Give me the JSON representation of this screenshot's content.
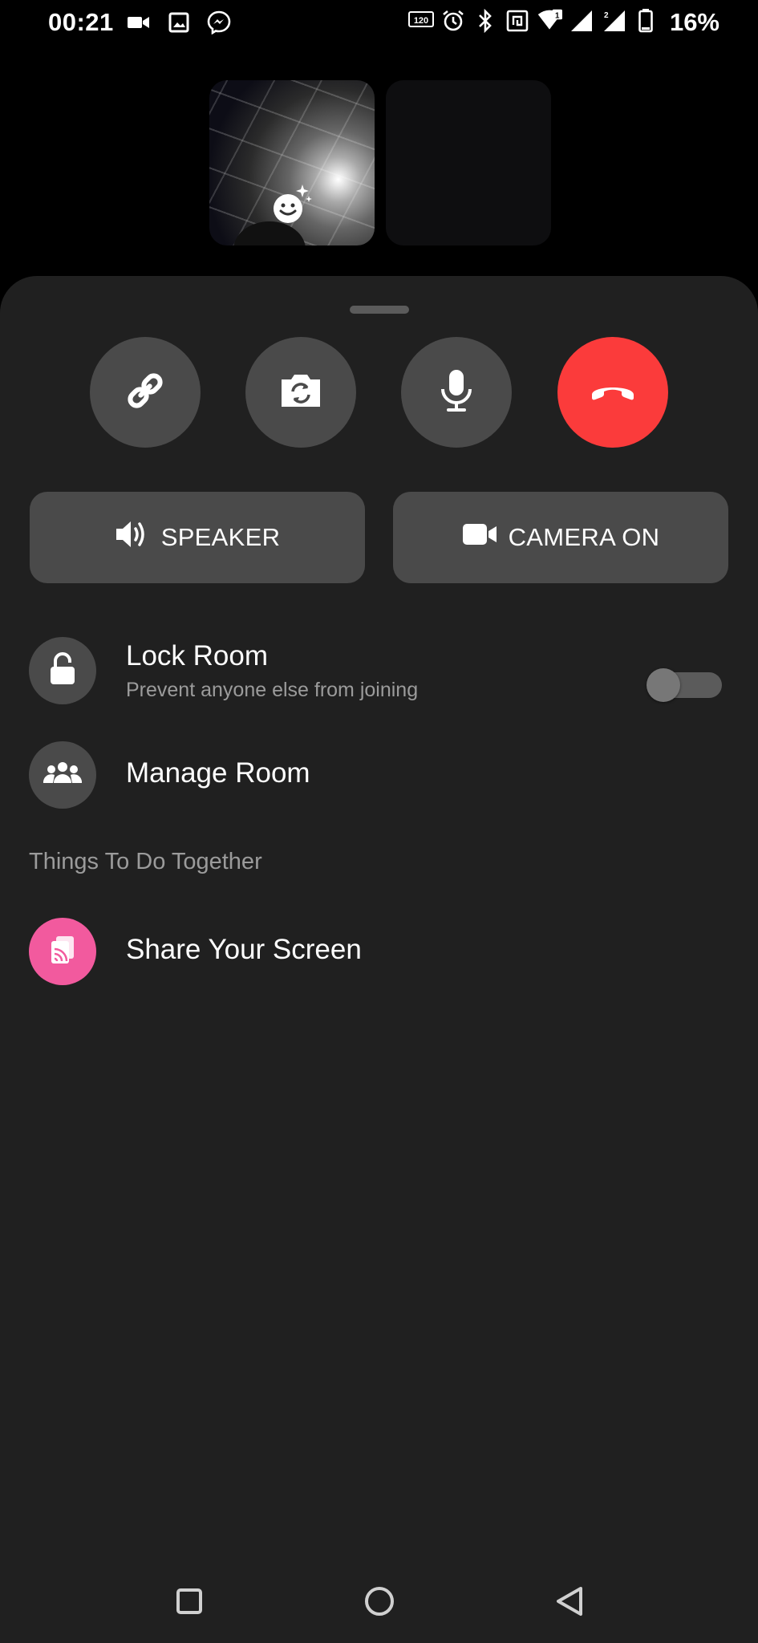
{
  "status_bar": {
    "time": "00:21",
    "left_icons": [
      "video-camera-icon",
      "image-icon",
      "messenger-icon"
    ],
    "right_icons": [
      "refresh-rate-120hz-icon",
      "alarm-icon",
      "bluetooth-icon",
      "nfc-icon",
      "wifi-icon",
      "signal-sim1-icon",
      "signal-sim2-icon",
      "battery-icon"
    ],
    "battery_percent": "16%"
  },
  "call_tiles": {
    "self_effects_icon": "face-effects-icon",
    "other_tile_state": "empty"
  },
  "controls": {
    "circle_buttons": [
      {
        "name": "link",
        "icon": "link-icon"
      },
      {
        "name": "flip-camera",
        "icon": "flip-camera-icon"
      },
      {
        "name": "microphone",
        "icon": "microphone-icon"
      },
      {
        "name": "end-call",
        "icon": "hang-up-icon",
        "color": "#fb3b3b"
      }
    ],
    "speaker_label": "SPEAKER",
    "camera_label": "CAMERA ON"
  },
  "lock_room": {
    "title": "Lock Room",
    "subtitle": "Prevent anyone else from joining",
    "toggle_on": false
  },
  "manage_room": {
    "title": "Manage Room"
  },
  "section": {
    "title": "Things To Do Together"
  },
  "share_screen": {
    "title": "Share Your Screen",
    "icon_color": "#f25a9e"
  },
  "colors": {
    "sheet": "#202020",
    "button": "#4a4a4a",
    "end_call": "#fb3b3b",
    "share_accent": "#f25a9e"
  }
}
